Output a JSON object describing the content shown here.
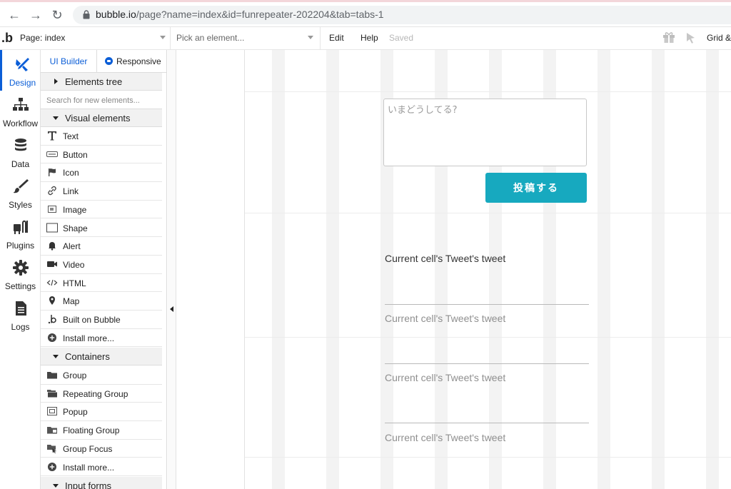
{
  "browser": {
    "url_host": "bubble.io",
    "url_path": "/page?name=index&id=funrepeater-202204&tab=tabs-1"
  },
  "topbar": {
    "page_label": "Page: index",
    "element_placeholder": "Pick an element...",
    "edit_label": "Edit",
    "help_label": "Help",
    "saved_label": "Saved",
    "grid_label": "Grid &"
  },
  "leftnav": {
    "items": [
      {
        "label": "Design",
        "icon": "design-icon",
        "active": true
      },
      {
        "label": "Workflow",
        "icon": "workflow-icon"
      },
      {
        "label": "Data",
        "icon": "database-icon"
      },
      {
        "label": "Styles",
        "icon": "brush-icon"
      },
      {
        "label": "Plugins",
        "icon": "plug-icon"
      },
      {
        "label": "Settings",
        "icon": "gear-icon"
      },
      {
        "label": "Logs",
        "icon": "document-icon"
      }
    ]
  },
  "panel": {
    "tabs": {
      "ui_builder": "UI Builder",
      "responsive": "Responsive"
    },
    "elements_tree": "Elements tree",
    "search_placeholder": "Search for new elements...",
    "visual_header": "Visual elements",
    "visual_items": [
      {
        "label": "Text",
        "icon": "text-icon"
      },
      {
        "label": "Button",
        "icon": "button-icon"
      },
      {
        "label": "Icon",
        "icon": "flag-icon"
      },
      {
        "label": "Link",
        "icon": "link-icon"
      },
      {
        "label": "Image",
        "icon": "image-icon"
      },
      {
        "label": "Shape",
        "icon": "shape-icon"
      },
      {
        "label": "Alert",
        "icon": "bell-icon"
      },
      {
        "label": "Video",
        "icon": "video-icon"
      },
      {
        "label": "HTML",
        "icon": "code-icon"
      },
      {
        "label": "Map",
        "icon": "map-pin-icon"
      },
      {
        "label": "Built on Bubble",
        "icon": "bubble-logo-icon"
      },
      {
        "label": "Install more...",
        "icon": "plus-circle-icon"
      }
    ],
    "containers_header": "Containers",
    "container_items": [
      {
        "label": "Group",
        "icon": "folder-icon"
      },
      {
        "label": "Repeating Group",
        "icon": "repeating-group-icon"
      },
      {
        "label": "Popup",
        "icon": "popup-icon"
      },
      {
        "label": "Floating Group",
        "icon": "floating-group-icon"
      },
      {
        "label": "Group Focus",
        "icon": "group-focus-icon"
      },
      {
        "label": "Install more...",
        "icon": "plus-circle-icon"
      }
    ],
    "input_forms_header": "Input forms"
  },
  "canvas": {
    "input_placeholder": "いまどうしてる?",
    "post_button": "投稿する",
    "cells": [
      "Current cell's Tweet's tweet",
      "Current cell's Tweet's tweet",
      "Current cell's Tweet's tweet",
      "Current cell's Tweet's tweet"
    ]
  },
  "colors": {
    "accent": "#0b5ed7",
    "post_button": "#17a9bf"
  }
}
